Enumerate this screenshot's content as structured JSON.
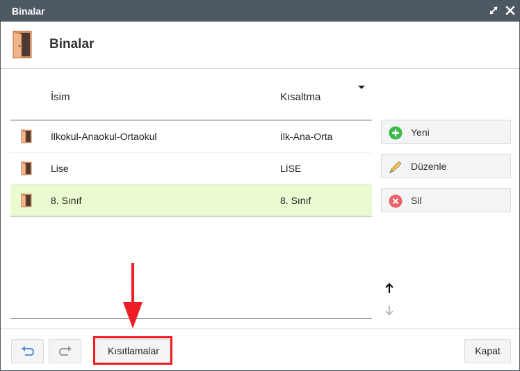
{
  "window": {
    "title": "Binalar",
    "maximize_icon": "maximize-icon",
    "close_icon": "close-icon"
  },
  "header": {
    "title": "Binalar",
    "icon": "door-icon"
  },
  "table": {
    "columns": {
      "name": "İsim",
      "abbreviation": "Kısaltma"
    },
    "sort_icon": "sort-down-arrow-icon",
    "rows": [
      {
        "name": "İlkokul-Anaokul-Ortaokul",
        "abbreviation": "İlk-Ana-Orta",
        "icon": "door-icon",
        "selected": false
      },
      {
        "name": "Lise",
        "abbreviation": "LİSE",
        "icon": "door-icon",
        "selected": false
      },
      {
        "name": "8. Sınıf",
        "abbreviation": "8. Sınıf",
        "icon": "door-icon",
        "selected": true
      }
    ]
  },
  "side_buttons": {
    "new": {
      "label": "Yeni",
      "icon": "plus-circle-icon"
    },
    "edit": {
      "label": "Düzenle",
      "icon": "pencil-icon"
    },
    "delete": {
      "label": "Sil",
      "icon": "x-circle-icon"
    }
  },
  "move": {
    "up_icon": "arrow-up-icon",
    "down_icon": "arrow-down-icon"
  },
  "footer": {
    "undo_icon": "undo-icon",
    "redo_icon": "redo-icon",
    "restrictions_label": "Kısıtlamalar",
    "close_label": "Kapat"
  },
  "colors": {
    "titlebar": "#4d5863",
    "selected_row": "#ebfad0",
    "annotation_red": "#ee1c24",
    "add_green": "#3cb94a",
    "delete_red": "#e8636b"
  }
}
